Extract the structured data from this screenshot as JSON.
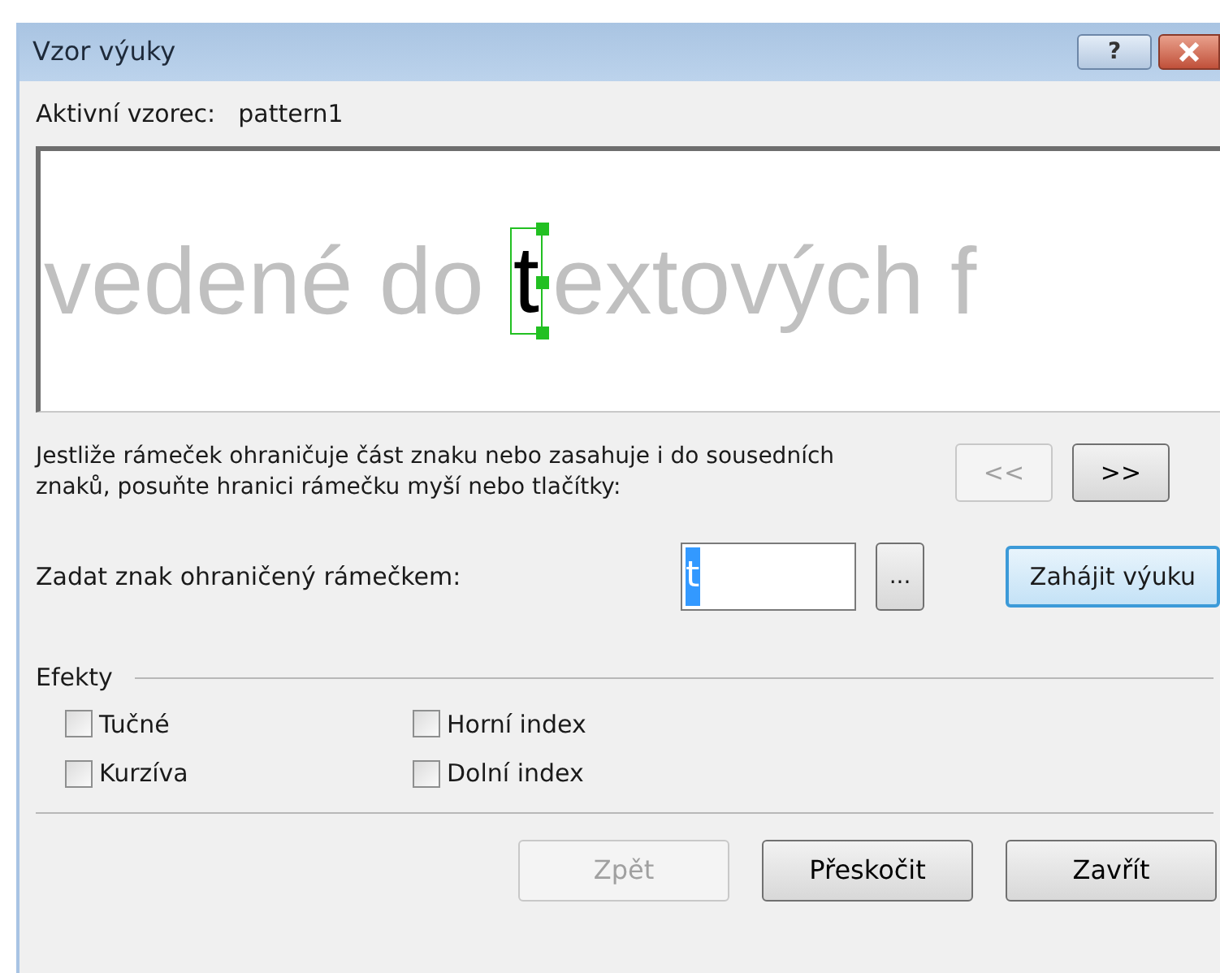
{
  "window": {
    "title": "Vzor výuky",
    "help_button": "?"
  },
  "active_pattern": {
    "label": "Aktivní vzorec:",
    "value": "pattern1"
  },
  "preview": {
    "before": "vedené do",
    "current": "t",
    "after": "extových f"
  },
  "instruction": "Jestliže rámeček ohraničuje část znaku nebo zasahuje i do sousedních znaků, posuňte hranici rámečku myší nebo tlačítky:",
  "nav_buttons": [
    {
      "label": "<<",
      "disabled": true
    },
    {
      "label": ">>",
      "disabled": false
    }
  ],
  "char_input": {
    "label": "Zadat znak ohraničený rámečkem:",
    "value": "t",
    "browse": "...",
    "start": "Zahájit výuku"
  },
  "effects": {
    "title": "Efekty",
    "options": [
      {
        "label": "Tučné",
        "checked": false
      },
      {
        "label": "Horní index",
        "checked": false
      },
      {
        "label": "Kurzíva",
        "checked": false
      },
      {
        "label": "Dolní index",
        "checked": false
      }
    ]
  },
  "buttons": [
    {
      "label": "Zpět",
      "disabled": true
    },
    {
      "label": "Přeskočit",
      "disabled": false
    },
    {
      "label": "Zavřít",
      "disabled": false
    }
  ]
}
